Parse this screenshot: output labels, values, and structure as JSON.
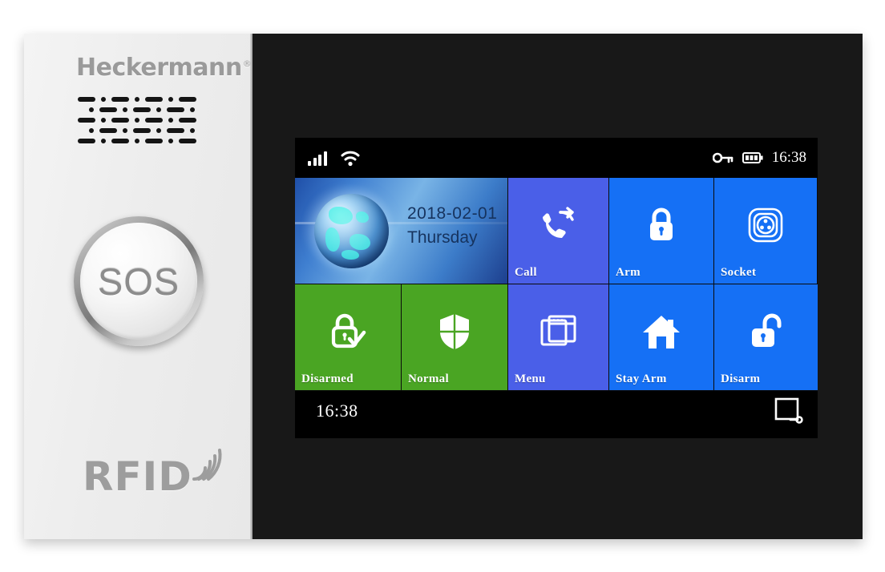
{
  "device": {
    "brand": "Heckermann",
    "brand_mark": "®",
    "sos_label": "SOS",
    "rfid_label": "RFID"
  },
  "screen": {
    "statusbar": {
      "signal_icon": "signal-bars-icon",
      "wifi_icon": "wifi-icon",
      "key_icon": "key-icon",
      "battery_icon": "battery-icon",
      "time": "16:38"
    },
    "date_tile": {
      "date": "2018-02-01",
      "weekday": "Thursday",
      "icon": "globe-icon"
    },
    "tiles": [
      {
        "label": "Call",
        "icon": "call-forward-icon",
        "color": "#4a5fe8"
      },
      {
        "label": "Arm",
        "icon": "lock-closed-icon",
        "color": "#1570f5"
      },
      {
        "label": "Socket",
        "icon": "power-socket-icon",
        "color": "#1570f5"
      },
      {
        "label": "Disarmed",
        "icon": "lock-check-icon",
        "color": "#4aa523"
      },
      {
        "label": "Normal",
        "icon": "shield-icon",
        "color": "#4aa523"
      },
      {
        "label": "Menu",
        "icon": "window-menu-icon",
        "color": "#4a5fe8"
      },
      {
        "label": "Stay Arm",
        "icon": "house-icon",
        "color": "#1570f5"
      },
      {
        "label": "Disarm",
        "icon": "lock-open-icon",
        "color": "#1570f5"
      }
    ],
    "bottombar": {
      "time": "16:38",
      "icon": "screen-key-icon"
    }
  },
  "colors": {
    "tile_blue_purple": "#4a5fe8",
    "tile_blue": "#1570f5",
    "tile_green": "#4aa523",
    "date_text": "#16335e",
    "panel_white": "#eeeeee",
    "bezel_black": "#181818"
  }
}
